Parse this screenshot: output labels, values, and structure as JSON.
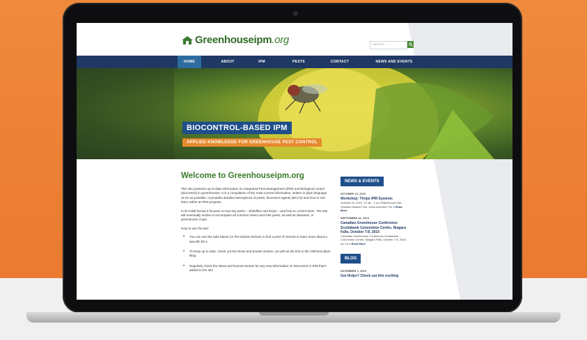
{
  "site": {
    "logo": {
      "name": "Greenhouseipm",
      "tld": ".org"
    },
    "search": {
      "placeholder": "SEARCH"
    },
    "nav": [
      {
        "label": "HOME",
        "active": true
      },
      {
        "label": "ABOUT"
      },
      {
        "label": "IPM"
      },
      {
        "label": "PESTS"
      },
      {
        "label": "CONTACT"
      },
      {
        "label": "NEWS AND EVENTS"
      }
    ],
    "hero": {
      "title": "BIOCONTROL-BASED IPM",
      "subtitle": "APPLIED KNOWLEDGE FOR GREENHOUSE PEST CONTROL"
    },
    "main": {
      "heading": "Welcome to Greenhouseipm.org",
      "paragraphs": [
        "This site presents up-to-date information on Integrated Pest Management (IPM) and biological control (biocontrol) in greenhouses. It is a  compilation of the most current information, written in plain language as far as possible. It provides detailed descriptions of pests, biocontrol agents (BCA's) and how to use them within an IPM program.",
        "In its initial format it focuses on  two key pests – whiteflies and thrips – and how to control them. The site will eventually evolve to encompass all common insect and mite pests, as well as diseases, in greenhouse crops.",
        "How to use the site:"
      ],
      "bullets": [
        "You can use the tabs above (or the buttons below!) to find a pest of interest or learn more about a specific BCA",
        "To keep up to date, check out the News and Events section, as well as the link to the ONFloriculture Blog",
        "Regularly check the News and Events section for any new information on biocontrol or IPM that's added to the site"
      ]
    },
    "sidebar": {
      "news_heading": "NEWS & EVENTS",
      "events": [
        {
          "date": "OCTOBER 13, 2015",
          "title": "Workshop: Thrips IPM Systems",
          "text": "October 26, 2015, 10 am - 2 pm Rittenhouse Hall, Vineland Station Free, lunch included. Ple",
          "more": "> Read More"
        },
        {
          "date": "SEPTEMBER 16, 2015",
          "title": "Canadian Greenhouse Conference Scotiabank Convention Centre, Niagara Falls, October 7-8, 2015",
          "text": "Canadian Greenhouse Conference Scotiabank Convention Centre, Niagara Falls, October 7-8, 2015. As Ca",
          "more": "> Read More"
        }
      ],
      "blog_heading": "BLOG",
      "blog_date": "NOVEMBER 2, 2015",
      "blog_title": "Got thrips? Check out this exciting"
    }
  }
}
